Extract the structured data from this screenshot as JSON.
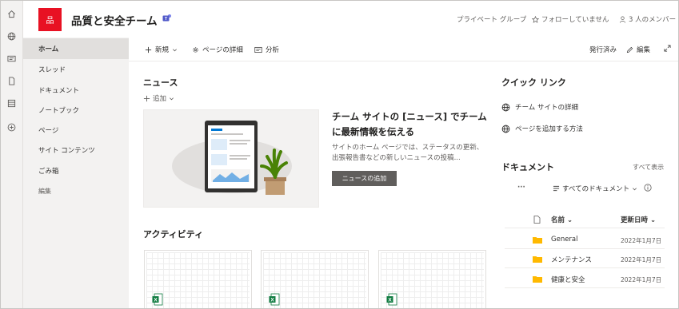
{
  "header": {
    "logo_glyph": "品",
    "site_title": "品質と安全チーム",
    "privacy": "プライベート グループ",
    "follow": "フォローしていません",
    "members": "3 人のメンバー"
  },
  "nav": {
    "items": [
      {
        "label": "ホーム",
        "active": true
      },
      {
        "label": "スレッド"
      },
      {
        "label": "ドキュメント"
      },
      {
        "label": "ノートブック"
      },
      {
        "label": "ページ"
      },
      {
        "label": "サイト コンテンツ"
      },
      {
        "label": "ごみ箱"
      }
    ],
    "edit": "編集"
  },
  "command_bar": {
    "new": "新規",
    "page_details": "ページの詳細",
    "analytics": "分析",
    "published": "発行済み",
    "edit": "編集"
  },
  "news": {
    "heading": "ニュース",
    "add": "追加",
    "title": "チーム サイトの [ニュース] でチームに最新情報を伝える",
    "body": "サイトのホーム ページでは、ステータスの更新、出張報告書などの新しいニュースの投稿...",
    "button": "ニュースの追加"
  },
  "activity": {
    "heading": "アクティビティ"
  },
  "quick_links": {
    "heading": "クイック リンク",
    "items": [
      "チーム サイトの詳細",
      "ページを追加する方法"
    ]
  },
  "documents": {
    "heading": "ドキュメント",
    "see_all": "すべて表示",
    "more": "···",
    "view": "すべてのドキュメント",
    "col_name": "名前",
    "col_modified": "更新日時",
    "rows": [
      {
        "name": "General",
        "date": "2022年1月7日"
      },
      {
        "name": "メンテナンス",
        "date": "2022年1月7日"
      },
      {
        "name": "健康と安全",
        "date": "2022年1月7日"
      }
    ]
  },
  "colors": {
    "logo": "#e81123",
    "folder": "#ffb900",
    "excel": "#107c41"
  }
}
